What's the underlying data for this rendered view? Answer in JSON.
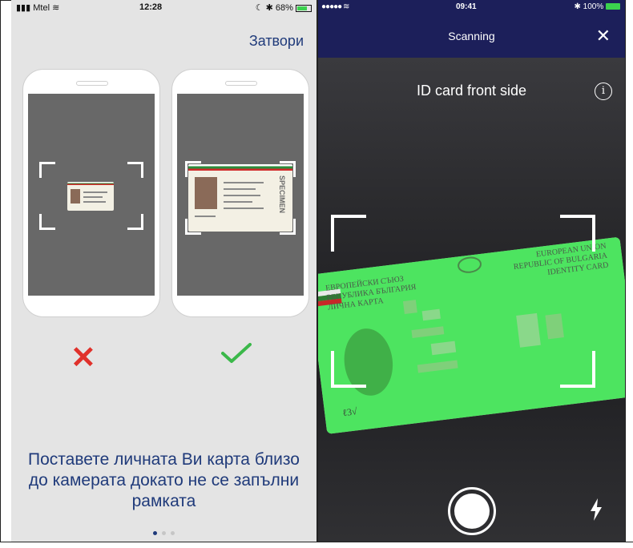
{
  "left_screen": {
    "status": {
      "carrier": "Mtel",
      "time": "12:28",
      "battery": "68%"
    },
    "close_label": "Затвори",
    "caption": "Поставете личната Ви карта близо до камерата докато не се запълни рамката",
    "page_dots": {
      "count": 3,
      "active": 1
    },
    "examples": [
      {
        "name": "card-too-far",
        "result": "wrong"
      },
      {
        "name": "card-filling-frame",
        "result": "correct",
        "card_text": "SPECIMEN"
      }
    ]
  },
  "right_screen": {
    "status": {
      "time": "09:41",
      "battery": "100%"
    },
    "title": "Scanning",
    "card_side_label": "ID card front side",
    "card_text": {
      "left_lines": [
        "ЕВРОПЕЙСКИ СЪЮЗ",
        "РЕПУБЛИКА БЪЛГАРИЯ",
        "ЛИЧНА КАРТА"
      ],
      "right_lines": [
        "EUROPEAN UNION",
        "REPUBLIC OF BULGARIA",
        "IDENTITY CARD"
      ]
    },
    "colors": {
      "header": "#1c1f5a",
      "overlay": "#2ee84a"
    }
  }
}
